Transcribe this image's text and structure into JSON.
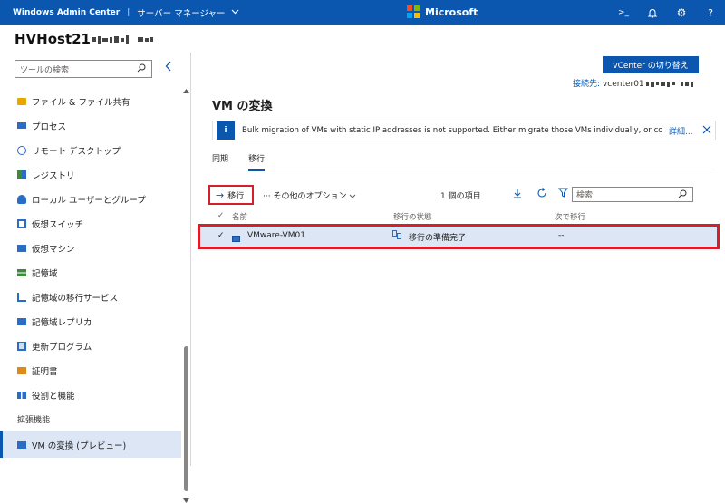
{
  "topbar": {
    "app_title": "Windows Admin Center",
    "separator": "|",
    "connection": "サーバー マネージャー",
    "brand": "Microsoft",
    "icons": [
      "terminal-icon",
      "bell-icon",
      "gear-icon",
      "help-icon"
    ],
    "icon_glyphs": {
      "terminal": ">_",
      "bell": "🔔︎",
      "gear": "⚙",
      "help": "?"
    }
  },
  "host": {
    "name": "HVHost21"
  },
  "sidebar": {
    "search_placeholder": "ツールの検索",
    "items": [
      {
        "label": "ファイル & ファイル共有",
        "icon": "folder-icon",
        "color": "#e8a600"
      },
      {
        "label": "プロセス",
        "icon": "process-icon",
        "color": "#2b6cc4"
      },
      {
        "label": "リモート デスクトップ",
        "icon": "remote-desktop-icon",
        "color": "#2b6cc4"
      },
      {
        "label": "レジストリ",
        "icon": "registry-icon",
        "color": "#3c8a3c"
      },
      {
        "label": "ローカル ユーザーとグループ",
        "icon": "users-icon",
        "color": "#2b6cc4"
      },
      {
        "label": "仮想スイッチ",
        "icon": "switch-icon",
        "color": "#2b6cc4"
      },
      {
        "label": "仮想マシン",
        "icon": "vm-icon",
        "color": "#2b6cc4"
      },
      {
        "label": "記憶域",
        "icon": "storage-icon",
        "color": "#3c8a3c"
      },
      {
        "label": "記憶域の移行サービス",
        "icon": "storage-migration-icon",
        "color": "#2b6cc4"
      },
      {
        "label": "記憶域レプリカ",
        "icon": "storage-replica-icon",
        "color": "#2b6cc4"
      },
      {
        "label": "更新プログラム",
        "icon": "updates-icon",
        "color": "#2b6cc4"
      },
      {
        "label": "証明書",
        "icon": "certificate-icon",
        "color": "#d98a1b"
      },
      {
        "label": "役割と機能",
        "icon": "roles-icon",
        "color": "#2b6cc4"
      }
    ],
    "section_label": "拡張機能",
    "active_item": {
      "label": "VM の変換 (プレビュー)",
      "icon": "vm-conversion-icon",
      "color": "#2b6cc4"
    }
  },
  "main": {
    "vcenter_button": "vCenter の切り替え",
    "destination_label": "接続先:",
    "destination_value": "vcenter01",
    "title": "VM の変換",
    "info": {
      "text": "Bulk migration of VMs with static IP addresses is not supported. Either migrate those VMs individually, or configure t...",
      "link": "詳細..."
    },
    "tabs": [
      "同期",
      "移行"
    ],
    "active_tab": "移行",
    "toolbar": {
      "migrate": "移行",
      "more": "その他のオプション",
      "count": "1 個の項目",
      "search_placeholder": "検索"
    },
    "grid": {
      "headers": [
        "名前",
        "移行の状態",
        "次で移行"
      ],
      "rows": [
        {
          "name": "VMware-VM01",
          "status": "移行の準備完了",
          "next": "--"
        }
      ]
    }
  },
  "colors": {
    "accent": "#0b57b0",
    "highlight": "#d3202a",
    "selected": "#dce6f5"
  }
}
